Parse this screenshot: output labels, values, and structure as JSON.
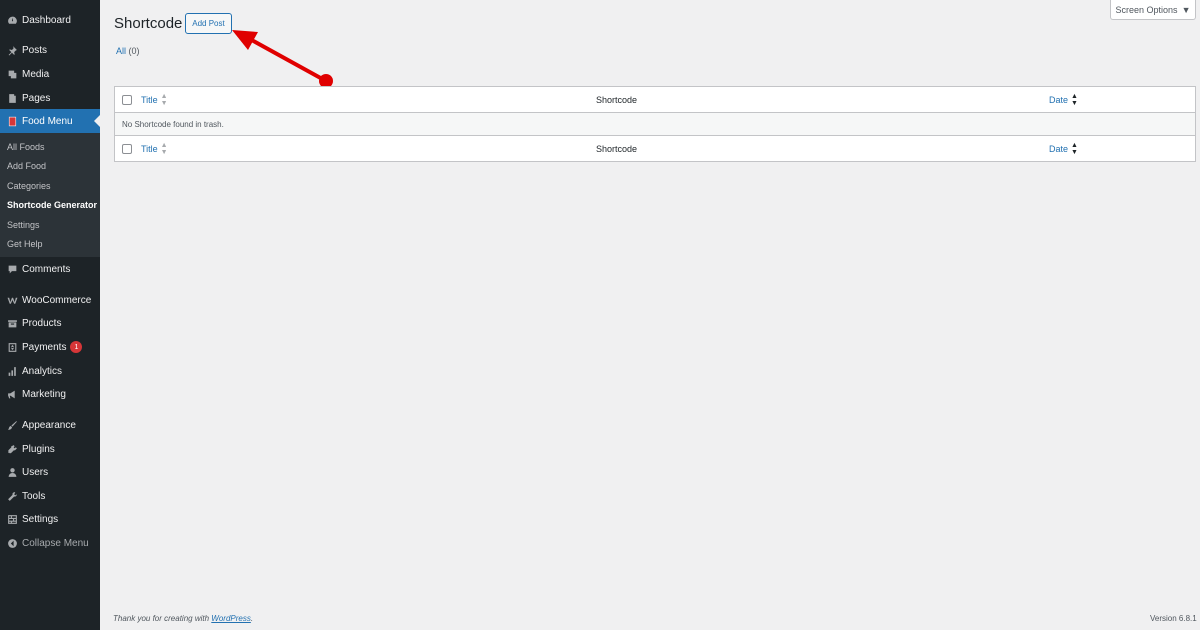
{
  "sidebar": {
    "items": [
      {
        "label": "Dashboard",
        "icon": "dashboard-icon"
      },
      {
        "label": "Posts",
        "icon": "pin-icon"
      },
      {
        "label": "Media",
        "icon": "media-icon"
      },
      {
        "label": "Pages",
        "icon": "pages-icon"
      },
      {
        "label": "Food Menu",
        "icon": "food-menu-icon"
      },
      {
        "label": "Comments",
        "icon": "comment-icon"
      },
      {
        "label": "WooCommerce",
        "icon": "woocommerce-icon"
      },
      {
        "label": "Products",
        "icon": "products-icon"
      },
      {
        "label": "Payments",
        "icon": "payments-icon",
        "badge": "1"
      },
      {
        "label": "Analytics",
        "icon": "analytics-icon"
      },
      {
        "label": "Marketing",
        "icon": "marketing-icon"
      },
      {
        "label": "Appearance",
        "icon": "brush-icon"
      },
      {
        "label": "Plugins",
        "icon": "plugin-icon"
      },
      {
        "label": "Users",
        "icon": "user-icon"
      },
      {
        "label": "Tools",
        "icon": "wrench-icon"
      },
      {
        "label": "Settings",
        "icon": "settings-icon"
      },
      {
        "label": "Collapse Menu",
        "icon": "collapse-icon"
      }
    ],
    "submenu": [
      "All Foods",
      "Add Food",
      "Categories",
      "Shortcode Generator",
      "Settings",
      "Get Help"
    ],
    "current_color": "#2271b1"
  },
  "page": {
    "title": "Shortcode",
    "add_button": "Add Post",
    "screen_options": "Screen Options",
    "filter_all": "All",
    "filter_count": "(0)"
  },
  "table": {
    "col_title": "Title",
    "col_shortcode": "Shortcode",
    "col_date": "Date",
    "empty_message": "No Shortcode found in trash."
  },
  "footer": {
    "thanks_text": "Thank you for creating with",
    "wordpress_link": "WordPress",
    "thanks_end": ".",
    "version": "Version 6.8.1"
  },
  "annotation": {
    "arrow_color": "#e00000"
  }
}
